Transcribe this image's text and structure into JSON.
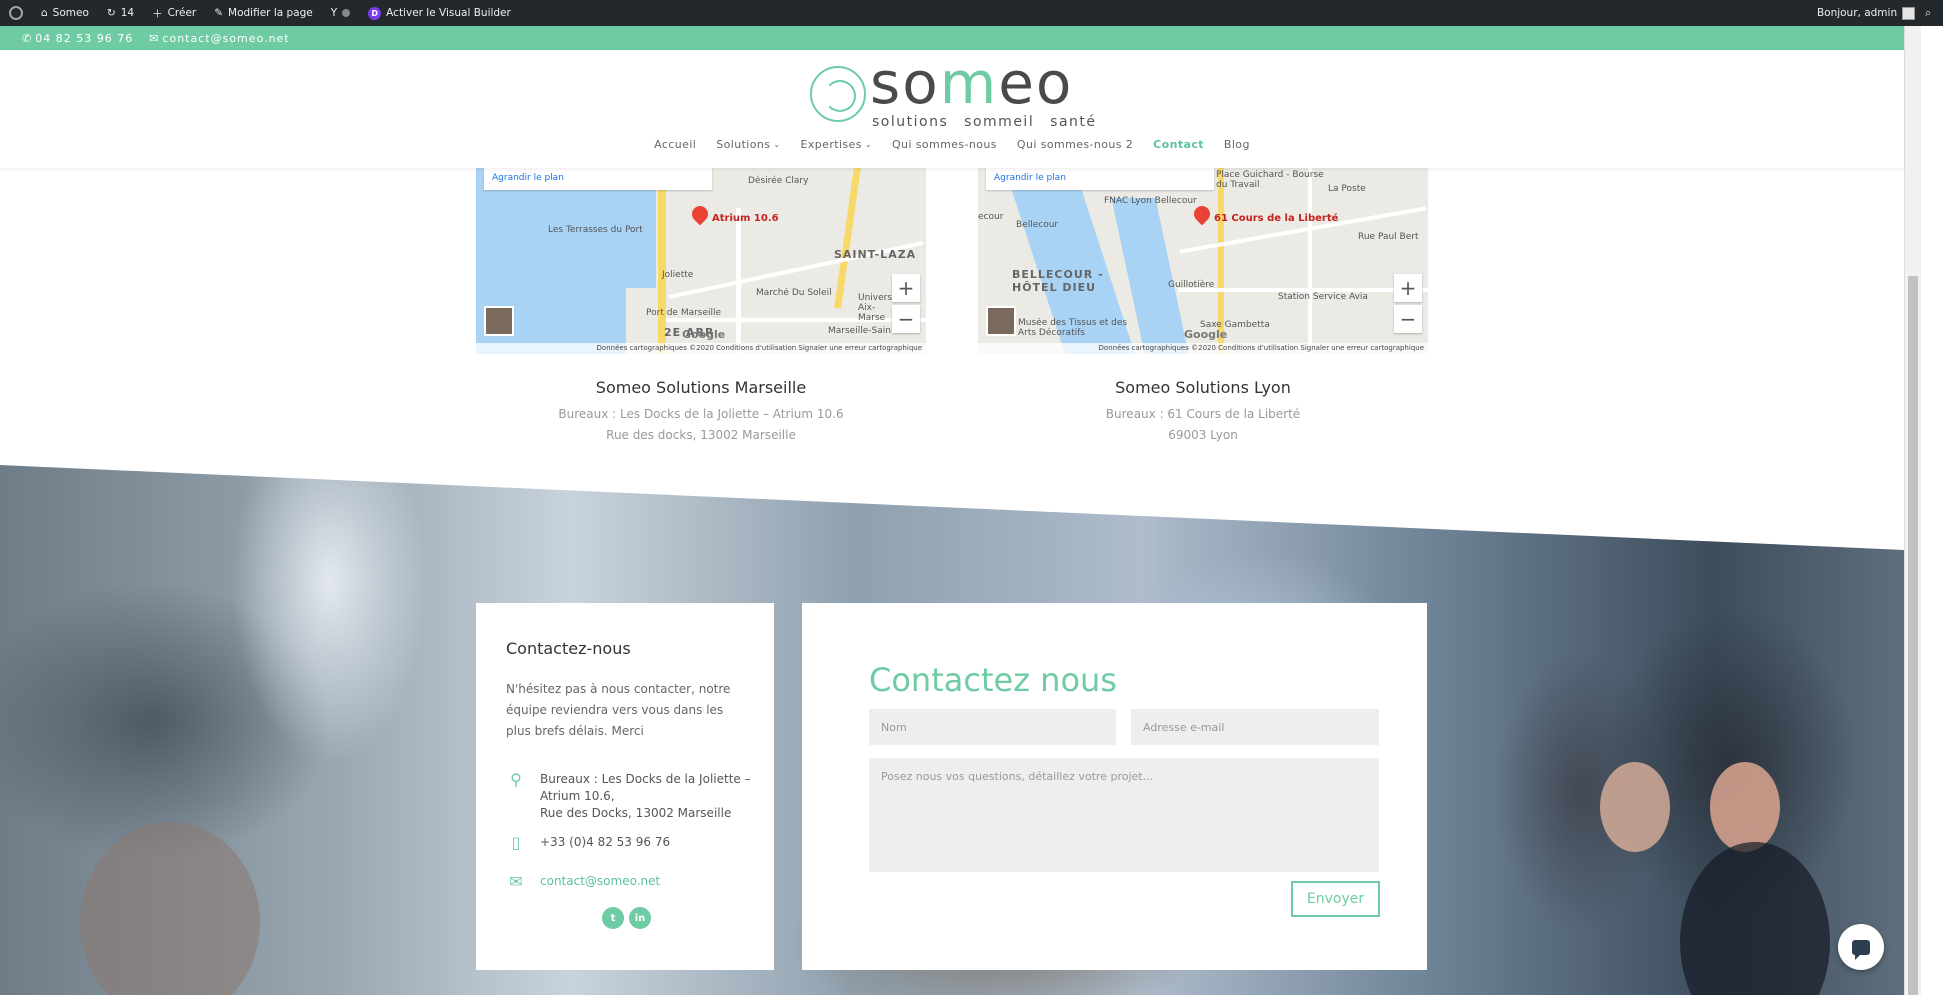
{
  "adminbar": {
    "site": "Someo",
    "updates": "14",
    "create": "Créer",
    "edit_page": "Modifier la page",
    "visual_builder": "Activer le Visual Builder",
    "greeting": "Bonjour, admin"
  },
  "topbar": {
    "phone": "04 82 53 96 76",
    "email": "contact@someo.net"
  },
  "logo": {
    "word_a": "so",
    "word_b": "m",
    "word_c": "eo",
    "tagline": "solutions sommeil santé"
  },
  "nav": [
    {
      "label": "Accueil"
    },
    {
      "label": "Solutions",
      "has_submenu": true
    },
    {
      "label": "Expertises",
      "has_submenu": true
    },
    {
      "label": "Qui sommes-nous"
    },
    {
      "label": "Qui sommes-nous 2"
    },
    {
      "label": "Contact",
      "active": true
    },
    {
      "label": "Blog"
    }
  ],
  "maps": [
    {
      "enlarge": "Agrandir le plan",
      "pin_label": "Atrium 10.6",
      "places": [
        "Désirée Clary",
        "Les Terrasses du Port",
        "Joliette",
        "Marché Du Soleil",
        "Port de Marseille",
        "SAINT-LAZA",
        "Univers Aix-Marse",
        "Marseille-Sain",
        "2E ARR"
      ],
      "footer": "Données cartographiques ©2020   Conditions d'utilisation   Signaler une erreur cartographique",
      "title": "Someo Solutions Marseille",
      "line1": "Bureaux  : Les Docks de la Joliette – Atrium 10.6",
      "line2": "Rue des docks, 13002 Marseille"
    },
    {
      "enlarge": "Agrandir le plan",
      "pin_label": "61 Cours de la Liberté",
      "places": [
        "FNAC Lyon Bellecour",
        "Place Guichard - Bourse du Travail",
        "La Poste",
        "Bellecour",
        "BELLECOUR - HÔTEL DIEU",
        "Guillotière",
        "Station Service Avia",
        "Musée des Tissus et des Arts Décoratifs",
        "Saxe Gambetta",
        "Rue Paul Bert",
        "ecour"
      ],
      "footer": "Données cartographiques ©2020   Conditions d'utilisation   Signaler une erreur cartographique",
      "title": "Someo Solutions Lyon",
      "line1": "Bureaux  : 61 Cours de la Liberté",
      "line2": "69003 Lyon"
    }
  ],
  "contact_info": {
    "title": "Contactez-nous",
    "intro": "N'hésitez pas à nous contacter, notre équipe reviendra vers vous dans les plus brefs délais. Merci",
    "address_1": "Bureaux : Les Docks de la Joliette –",
    "address_2": "Atrium 10.6,",
    "address_3": "Rue des Docks, 13002 Marseille",
    "phone": "+33 (0)4 82 53 96 76",
    "email": "contact@someo.net",
    "social": [
      "twitter",
      "linkedin"
    ]
  },
  "form": {
    "title": "Contactez nous",
    "name_placeholder": "Nom",
    "email_placeholder": "Adresse e-mail",
    "message_placeholder": "Posez nous vos questions, détaillez votre projet...",
    "submit": "Envoyer"
  },
  "colors": {
    "accent": "#6fcba3",
    "adminbar": "#23282d"
  }
}
